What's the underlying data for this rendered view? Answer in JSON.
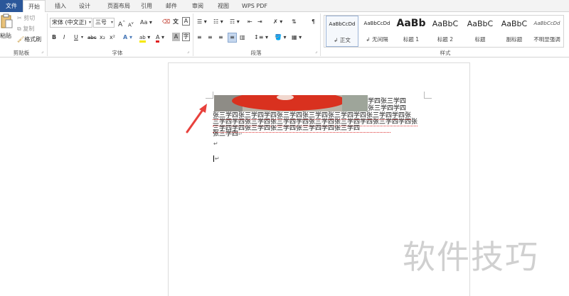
{
  "tabs": [
    "文件",
    "开始",
    "插入",
    "设计",
    "页面布局",
    "引用",
    "邮件",
    "审阅",
    "视图",
    "WPS PDF"
  ],
  "clipboard": {
    "paste_label": "粘贴",
    "cut_label": "剪切",
    "copy_label": "复制",
    "format_painter_label": "格式刷",
    "group_label": "剪贴板"
  },
  "font": {
    "font_name": "宋体 (中文正)",
    "font_size": "三号",
    "bold": "B",
    "italic": "I",
    "underline": "U",
    "strikethrough": "abc",
    "subscript": "x₂",
    "superscript": "x²",
    "grow": "A",
    "shrink": "A",
    "change_case": "Aa",
    "text_effects": "A",
    "highlight": "ab",
    "font_color": "A",
    "char_shading": "A",
    "char_border": "A",
    "clear_format": "A",
    "group_label": "字体"
  },
  "paragraph": {
    "group_label": "段落"
  },
  "styles": {
    "group_label": "样式",
    "items": [
      {
        "preview": "AaBbCcDd",
        "name": "正文"
      },
      {
        "preview": "AaBbCcDd",
        "name": "无间隔"
      },
      {
        "preview": "AaBb",
        "name": "标题 1"
      },
      {
        "preview": "AaBbC",
        "name": "标题 2"
      },
      {
        "preview": "AaBbC",
        "name": "标题"
      },
      {
        "preview": "AaBbC",
        "name": "副标题"
      },
      {
        "preview": "AaBbCcDd",
        "name": "不明显强调"
      }
    ]
  },
  "document": {
    "line1": "学四张三学四",
    "line2": "张三学四学四",
    "line3": "张三学四张三学四学四张三学四张三学四张三学四学四张三学四学四张",
    "line4": "三学四学四张三学四张三学四学四张三学四张三学四学四张三学四学四张",
    "line5": "三学四学四张三学四张三学四张三学四学四张三学四",
    "line6": "张三学四",
    "para_mark": "↵"
  },
  "watermark": "软件技巧",
  "colors": {
    "file_tab": "#2b579a",
    "arrow": "#e8413c",
    "photo_red": "#d9311f"
  }
}
